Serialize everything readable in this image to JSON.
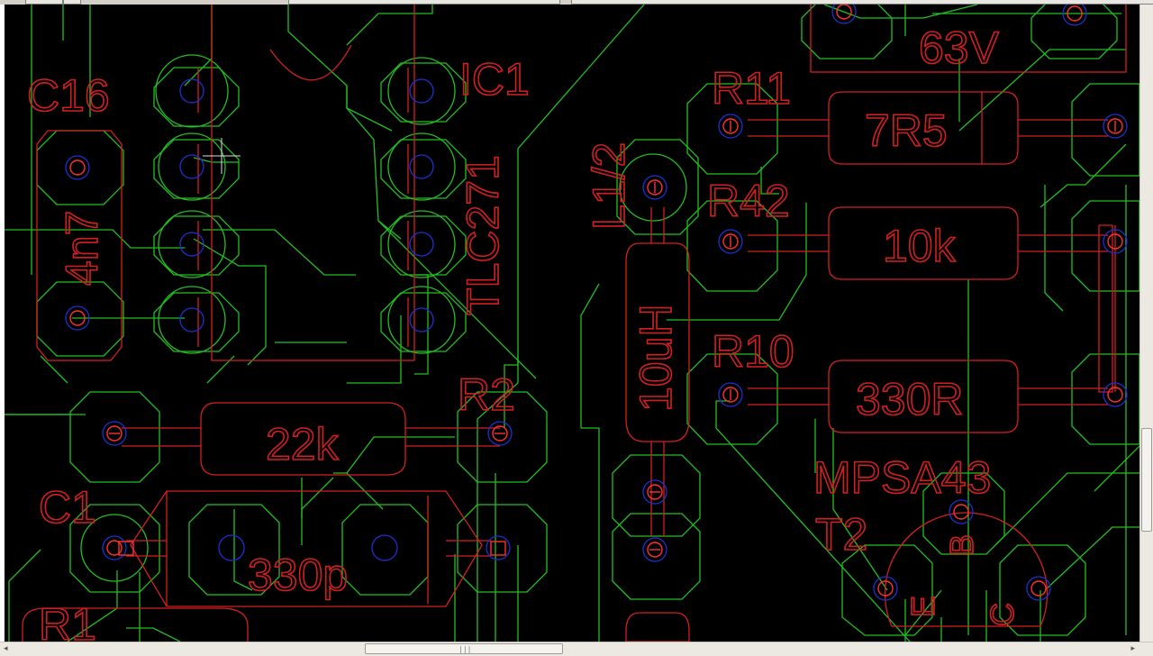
{
  "app": {
    "view": "board-editor"
  },
  "layers": {
    "silk_color": "#d22020",
    "route_color": "#22c022",
    "drill_color": "#2030d0",
    "pad_color": "#ff3030"
  },
  "components": {
    "c16": {
      "name": "C16",
      "value": "4n7"
    },
    "ic1": {
      "name": "IC1",
      "value": "TLC271"
    },
    "top_cap": {
      "value": "63V"
    },
    "r11": {
      "name": "R11",
      "value": "7R5"
    },
    "l1": {
      "name": "L1/2",
      "value": "10uH"
    },
    "r42": {
      "name": "R42",
      "value": "10k"
    },
    "r10": {
      "name": "R10",
      "value": "330R"
    },
    "r2": {
      "name": "R2",
      "value": "22k"
    },
    "c1": {
      "name": "C1",
      "value": "330p"
    },
    "r1": {
      "name": "R1"
    },
    "t2": {
      "name": "T2",
      "value": "MPSA43",
      "pin_b": "B",
      "pin_e": "E",
      "pin_c": "C"
    }
  },
  "scrollbars": {
    "horizontal_grip": "|||"
  }
}
